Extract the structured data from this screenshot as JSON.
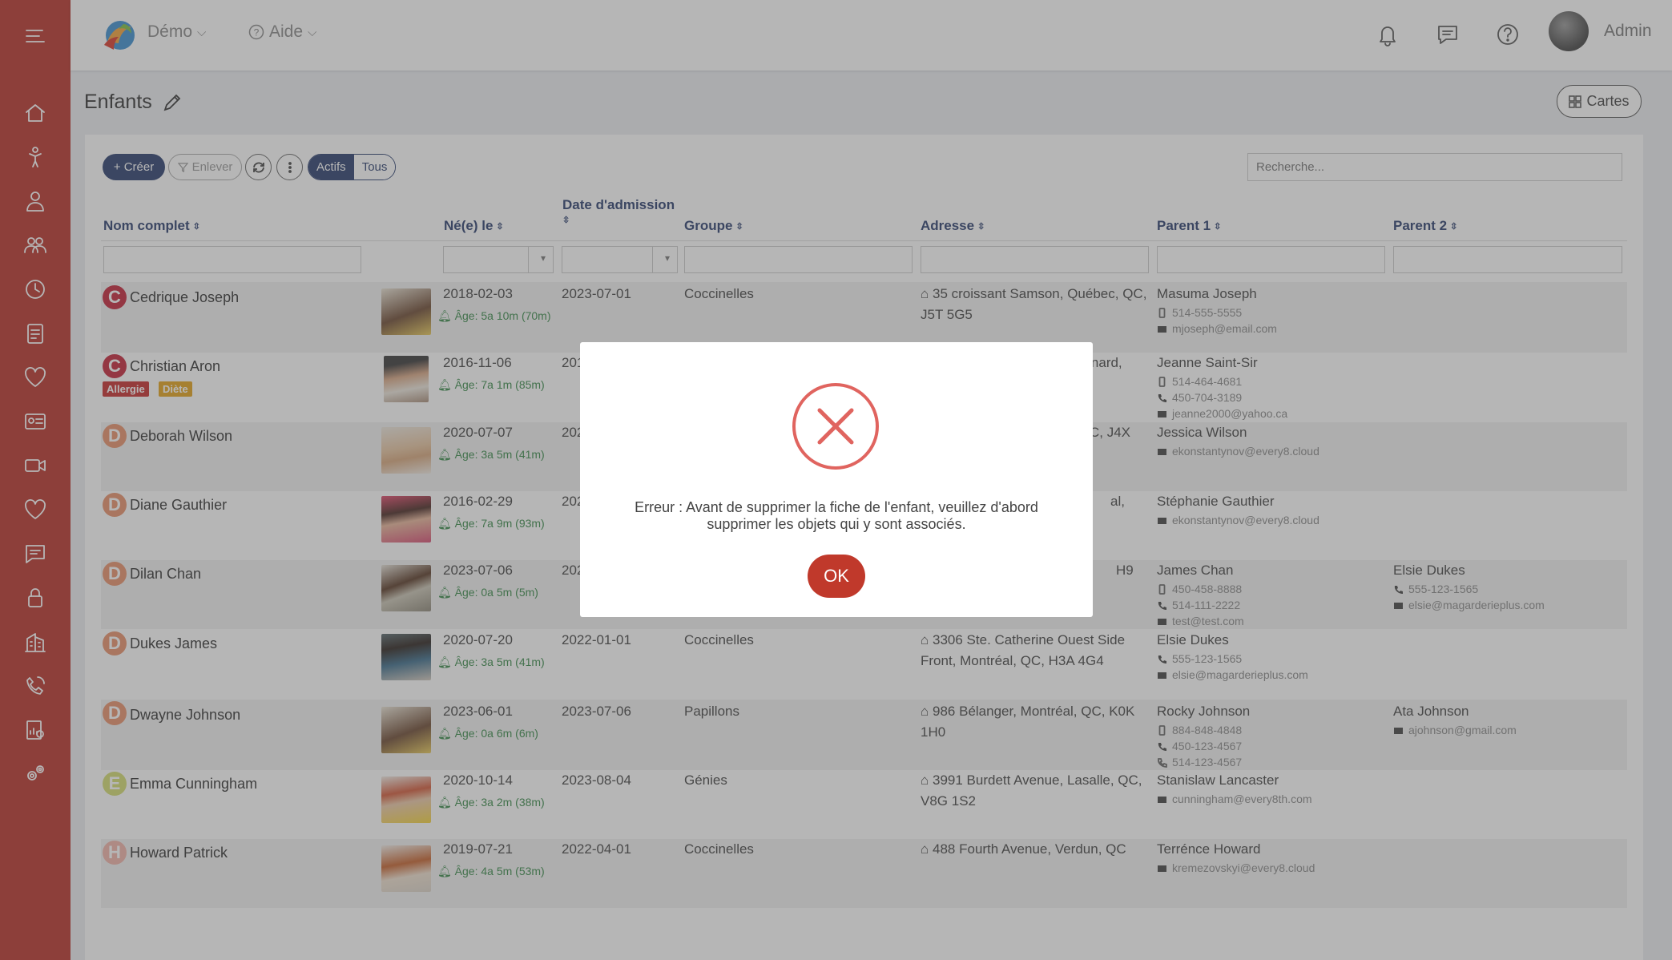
{
  "topbar": {
    "org_label": "Démo",
    "help_label": "Aide",
    "user_name": "Admin"
  },
  "page": {
    "title": "Enfants",
    "cards_label": "Cartes"
  },
  "toolbar": {
    "create_label": "+ Créer",
    "remove_label": "Enlever",
    "active_label": "Actifs",
    "all_label": "Tous",
    "search_placeholder": "Recherche..."
  },
  "columns": {
    "name": "Nom complet",
    "born": "Né(e) le",
    "admission": "Date d'admission",
    "group": "Groupe",
    "address": "Adresse",
    "parent1": "Parent 1",
    "parent2": "Parent 2"
  },
  "rows": [
    {
      "letter": "C",
      "name": "Cedrique Joseph",
      "born": "2018-02-03",
      "age": "Âge: 5a 10m (70m)",
      "admission": "2023-07-01",
      "group": "Coccinelles",
      "address": "35 croissant Samson, Québec, QC, J5T 5G5",
      "p1_name": "Masuma Joseph",
      "p1_l1": "514-555-5555",
      "p1_l2": "mjoseph@email.com",
      "p1_l3": "",
      "p2_name": "",
      "p2_l1": "",
      "p2_l2": ""
    },
    {
      "letter": "C",
      "name": "Christian Aron",
      "badge1": "Allergie",
      "badge2": "Diète",
      "born": "2016-11-06",
      "age": "Âge: 7a 1m (85m)",
      "admission": "2017-01-01",
      "group": "",
      "address": "onnard,",
      "p1_name": "Jeanne Saint-Sir",
      "p1_l1": "514-464-4681",
      "p1_l2": "450-704-3189",
      "p1_l3": "jeanne2000@yahoo.ca",
      "p2_name": "",
      "p2_l1": "",
      "p2_l2": ""
    },
    {
      "letter": "D",
      "name": "Deborah Wilson",
      "born": "2020-07-07",
      "age": "Âge: 3a 5m (41m)",
      "admission": "2023",
      "group": "",
      "address": "C, J4X",
      "p1_name": "Jessica Wilson",
      "p1_l1": "ekonstantynov@every8.cloud",
      "p1_l2": "",
      "p1_l3": "",
      "p2_name": "",
      "p2_l1": "",
      "p2_l2": ""
    },
    {
      "letter": "D",
      "name": "Diane Gauthier",
      "born": "2016-02-29",
      "age": "Âge: 7a 9m (93m)",
      "admission": "2023",
      "group": "",
      "address": "al,",
      "p1_name": "Stéphanie Gauthier",
      "p1_l1": "ekonstantynov@every8.cloud",
      "p1_l2": "",
      "p1_l3": "",
      "p2_name": "",
      "p2_l1": "",
      "p2_l2": ""
    },
    {
      "letter": "D",
      "name": "Dilan Chan",
      "born": "2023-07-06",
      "age": "Âge: 0a 5m (5m)",
      "admission": "2023",
      "group": "",
      "address": "H9",
      "p1_name": "James Chan",
      "p1_l1": "450-458-8888",
      "p1_l2": "514-111-2222",
      "p1_l3": "test@test.com",
      "p2_name": "Elsie Dukes",
      "p2_l1": "555-123-1565",
      "p2_l2": "elsie@magarderieplus.com"
    },
    {
      "letter": "D",
      "name": "Dukes James",
      "born": "2020-07-20",
      "age": "Âge: 3a 5m (41m)",
      "admission": "2022-01-01",
      "group": "Coccinelles",
      "address": "3306 Ste. Catherine Ouest Side Front, Montréal, QC, H3A 4G4",
      "p1_name": "Elsie Dukes",
      "p1_l1": "555-123-1565",
      "p1_l2": "elsie@magarderieplus.com",
      "p1_l3": "",
      "p2_name": "",
      "p2_l1": "",
      "p2_l2": ""
    },
    {
      "letter": "D",
      "name": "Dwayne Johnson",
      "born": "2023-06-01",
      "age": "Âge: 0a 6m (6m)",
      "admission": "2023-07-06",
      "group": "Papillons",
      "address": "986 Bélanger, Montréal, QC, K0K 1H0",
      "p1_name": "Rocky Johnson",
      "p1_l1": "884-848-4848",
      "p1_l2": "450-123-4567",
      "p1_l3": "514-123-4567",
      "p2_name": "Ata Johnson",
      "p2_l1": "ajohnson@gmail.com",
      "p2_l2": ""
    },
    {
      "letter": "E",
      "name": "Emma Cunningham",
      "born": "2020-10-14",
      "age": "Âge: 3a 2m (38m)",
      "admission": "2023-08-04",
      "group": "Génies",
      "address": "3991 Burdett Avenue, Lasalle, QC, V8G 1S2",
      "p1_name": "Stanislaw Lancaster",
      "p1_l1": "cunningham@every8th.com",
      "p1_l2": "",
      "p1_l3": "",
      "p2_name": "",
      "p2_l1": "",
      "p2_l2": ""
    },
    {
      "letter": "H",
      "name": "Howard Patrick",
      "born": "2019-07-21",
      "age": "Âge: 4a 5m (53m)",
      "admission": "2022-04-01",
      "group": "Coccinelles",
      "address": "488 Fourth Avenue, Verdun, QC",
      "p1_name": "Terrénce Howard",
      "p1_l1": "kremezovskyi@every8.cloud",
      "p1_l2": "",
      "p1_l3": "",
      "p2_name": "",
      "p2_l1": "",
      "p2_l2": ""
    }
  ],
  "modal": {
    "message": "Erreur : Avant de supprimer la fiche de l'enfant, veuillez d'abord supprimer les objets qui y sont associés.",
    "ok_label": "OK",
    "icon": "error-x-icon"
  },
  "colors": {
    "sidebar": "#b8322a",
    "primary": "#2c3f6e",
    "error": "#e0645f",
    "ok_button": "#c0392b"
  }
}
